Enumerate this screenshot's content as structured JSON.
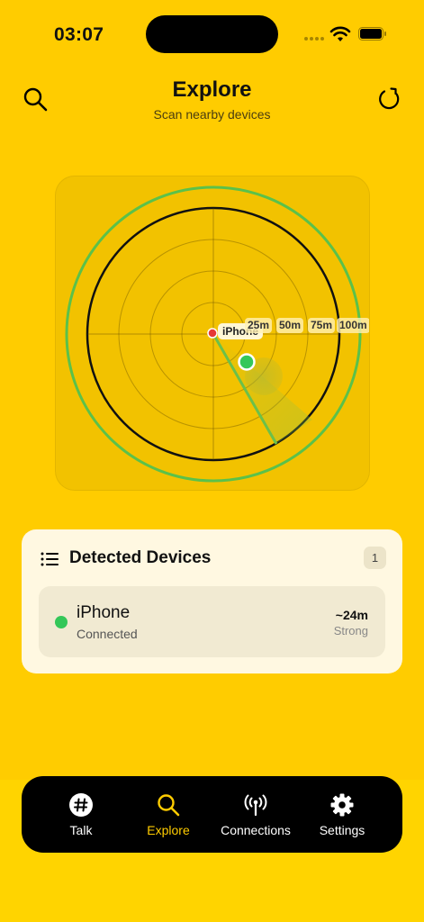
{
  "status_bar": {
    "time": "03:07"
  },
  "header": {
    "title": "Explore",
    "subtitle": "Scan nearby devices"
  },
  "radar": {
    "center_label": "iPhone",
    "rings": [
      "25m",
      "50m",
      "75m",
      "100m"
    ],
    "detected_device": {
      "name": "iPhone",
      "distance_m": 24
    }
  },
  "devices": {
    "title": "Detected Devices",
    "count": "1",
    "items": [
      {
        "name": "iPhone",
        "status": "Connected",
        "distance": "~24m",
        "signal": "Strong"
      }
    ]
  },
  "tabs": [
    {
      "label": "Talk",
      "icon": "hash-icon",
      "active": false
    },
    {
      "label": "Explore",
      "icon": "search-icon",
      "active": true
    },
    {
      "label": "Connections",
      "icon": "antenna-icon",
      "active": false
    },
    {
      "label": "Settings",
      "icon": "gear-icon",
      "active": false
    }
  ],
  "colors": {
    "background": "#FFCC00",
    "accent": "#FFCC00",
    "connected": "#34C759",
    "self": "#E53935"
  }
}
